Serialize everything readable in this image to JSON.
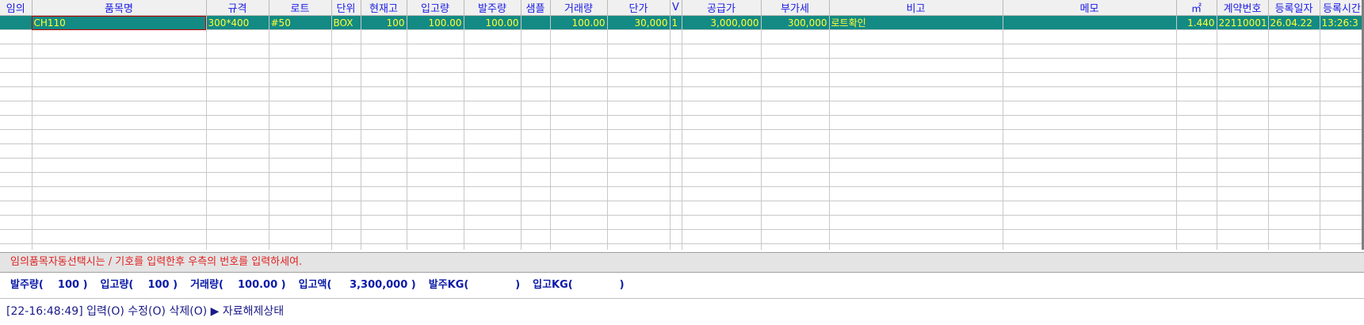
{
  "grid": {
    "columns": [
      "임의",
      "품목명",
      "규격",
      "로트",
      "단위",
      "현재고",
      "입고량",
      "발주량",
      "샘플",
      "거래량",
      "단가",
      "V",
      "공급가",
      "부가세",
      "비고",
      "메모",
      "㎡",
      "계약번호",
      "등록일자",
      "등록시간"
    ],
    "rows": [
      [
        "",
        "CH110",
        "300*400",
        "#50",
        "BOX",
        "100",
        "100.00",
        "100.00",
        "",
        "100.00",
        "30,000",
        "1",
        "3,000,000",
        "300,000",
        "로트확인",
        "",
        "1.440",
        "22110001",
        "26.04.22",
        "13:26:3"
      ]
    ]
  },
  "notice": "임의품목자동선택시는 / 기호를 입력한후 우측의 번호를 입력하세여.",
  "summary": {
    "order_qty": "발주량(    100 )",
    "in_qty": "입고량(    100 )",
    "trade_qty": "거래량(    100.00 )",
    "in_amount": "입고액(     3,300,000 )",
    "order_kg": "발주KG(             )",
    "in_kg": "입고KG(             )"
  },
  "status": {
    "time": "[22-16:48:49]",
    "input": "입력(O)",
    "edit": "수정(O)",
    "delete": "삭제(O)",
    "arrow": "▶",
    "state": "자료해제상태"
  }
}
